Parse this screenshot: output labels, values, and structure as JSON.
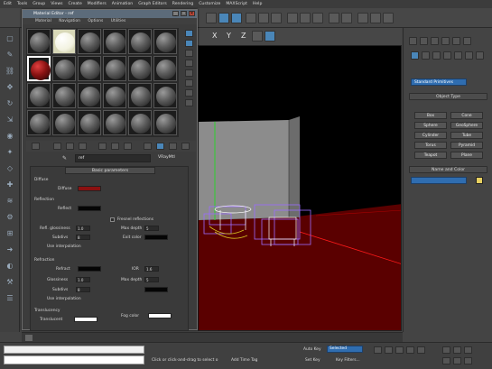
{
  "menu": [
    "Edit",
    "Tools",
    "Group",
    "Views",
    "Create",
    "Modifiers",
    "Animation",
    "Graph Editors",
    "Rendering",
    "Customize",
    "MAXScript",
    "Help"
  ],
  "viewport": {
    "axes": [
      "X",
      "Y",
      "Z"
    ]
  },
  "material_editor": {
    "title": "Material Editor - ref",
    "menu": [
      "Material",
      "Navigation",
      "Options",
      "Utilities"
    ],
    "material_name": "ref",
    "material_type": "VRayMtl",
    "rollout_title": "Basic parameters",
    "diffuse_group": "Diffuse",
    "diffuse_label": "Diffuse",
    "diffuse_color": "#8b1010",
    "reflection_group": "Reflection",
    "reflect_label": "Reflect",
    "fresnel_label": "Fresnel reflections",
    "refl_gloss_label": "Refl. glossiness",
    "refl_gloss_value": "1.0",
    "max_depth_label": "Max depth",
    "max_depth_value": "5",
    "subdivs_label": "Subdivs",
    "subdivs_value": "8",
    "use_interp_label": "Use interpolation",
    "exit_color_label": "Exit color",
    "refraction_group": "Refraction",
    "refract_label": "Refract",
    "ior_label": "IOR",
    "ior_value": "1.6",
    "gloss_label": "Glossiness",
    "gloss_value": "1.0",
    "refr_max_depth_value": "5",
    "refr_subdivs_value": "8",
    "translucency_label": "Translucency",
    "translucent_label": "Translucent",
    "fog_color_label": "Fog color"
  },
  "command_panel": {
    "category": "Standard Primitives",
    "object_type_title": "Object Type",
    "buttons": [
      "Box",
      "Cone",
      "Sphere",
      "GeoSphere",
      "Cylinder",
      "Tube",
      "Torus",
      "Pyramid",
      "Teapot",
      "Plane"
    ],
    "name_color_title": "Name and Color"
  },
  "bottom": {
    "prompt": "Click or click-and-drag to select o",
    "add_time_tag": "Add Time Tag",
    "auto_key": "Auto Key",
    "selected": "Selected",
    "set_key": "Set Key",
    "key_filters": "Key Filters..."
  },
  "colors": {
    "accent_blue": "#2f6db0",
    "floor_red": "#5a0000",
    "viewport_bg": "#000000"
  }
}
